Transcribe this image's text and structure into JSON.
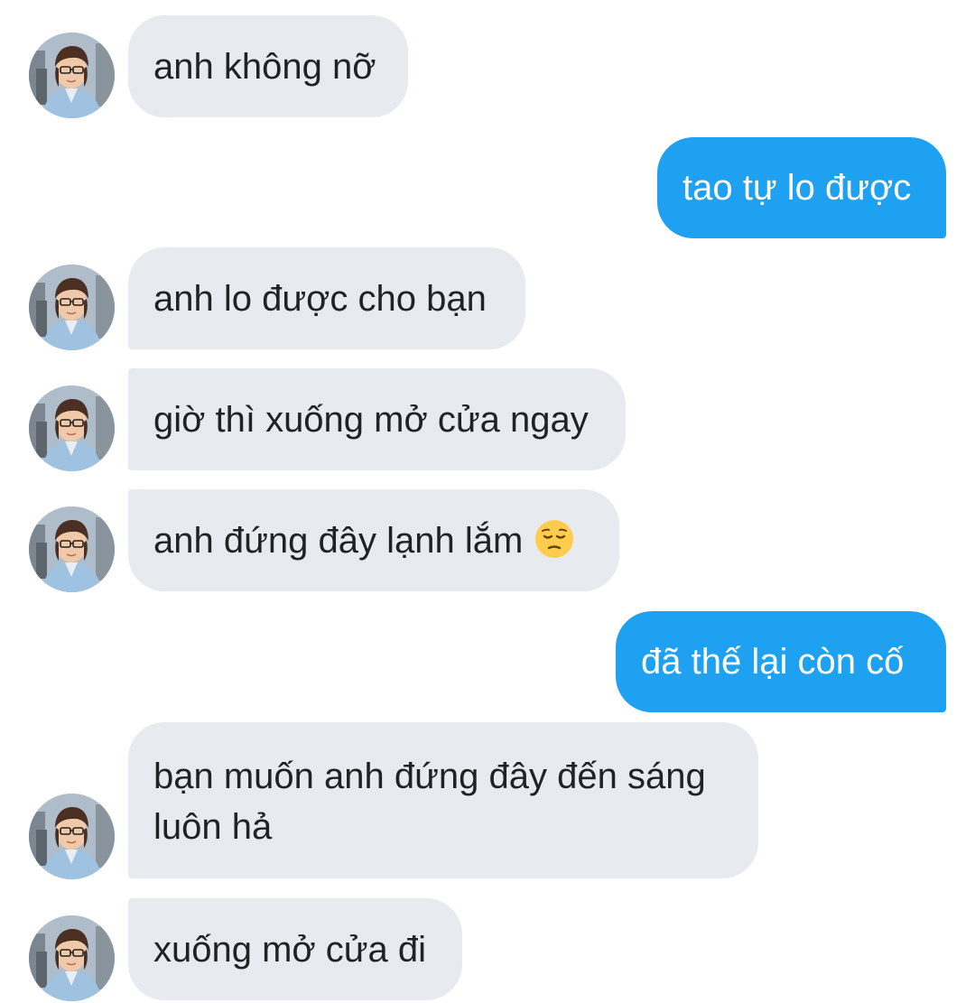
{
  "colors": {
    "incoming_bubble": "#e7ebef",
    "outgoing_bubble": "#1fa1f1",
    "outgoing_text": "#ffffff",
    "incoming_text": "#1f2326"
  },
  "messages": [
    {
      "direction": "incoming",
      "text": "anh không nỡ"
    },
    {
      "direction": "outgoing",
      "text": "tao tự lo được"
    },
    {
      "direction": "incoming",
      "text": "anh lo được cho bạn"
    },
    {
      "direction": "incoming",
      "text": "giờ thì xuống mở cửa ngay"
    },
    {
      "direction": "incoming",
      "text": "anh đứng đây lạnh lắm",
      "emoji": "pensive-face-icon"
    },
    {
      "direction": "outgoing",
      "text": "đã thế lại còn cố"
    },
    {
      "direction": "incoming",
      "text": "bạn muốn anh đứng đây đến sáng luôn hả"
    },
    {
      "direction": "incoming",
      "text": "xuống mở cửa đi"
    }
  ]
}
